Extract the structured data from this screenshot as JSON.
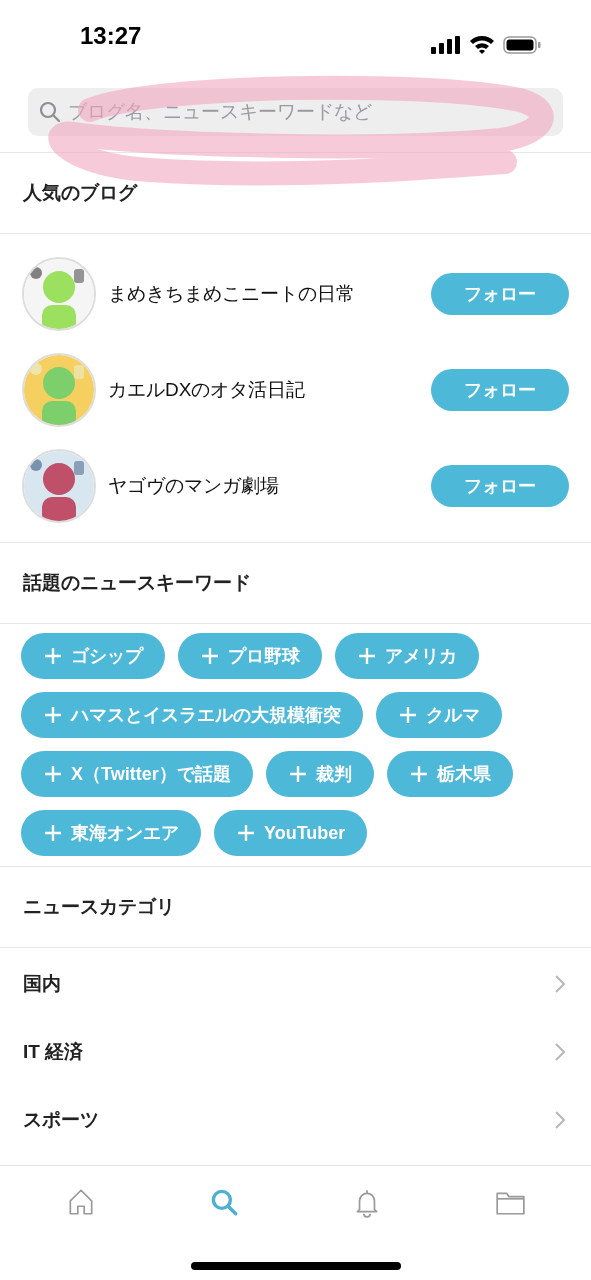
{
  "status_bar": {
    "time": "13:27"
  },
  "search": {
    "placeholder": "ブログ名、ニュースキーワードなど"
  },
  "popular_blogs": {
    "title": "人気のブログ",
    "items": [
      {
        "name": "まめきちまめこニートの日常",
        "button": "フォロー"
      },
      {
        "name": "カエルDXのオタ活日記",
        "button": "フォロー"
      },
      {
        "name": "ヤゴヴのマンガ劇場",
        "button": "フォロー"
      }
    ]
  },
  "keywords": {
    "title": "話題のニュースキーワード",
    "items": [
      "ゴシップ",
      "プロ野球",
      "アメリカ",
      "ハマスとイスラエルの大規模衝突",
      "クルマ",
      "X（Twitter）で話題",
      "裁判",
      "栃木県",
      "東海オンエア",
      "YouTuber"
    ]
  },
  "categories": {
    "title": "ニュースカテゴリ",
    "items": [
      "国内",
      "IT 経済",
      "スポーツ"
    ]
  },
  "tab_bar": [
    {
      "kind": "home",
      "selected": false
    },
    {
      "kind": "search",
      "selected": true
    },
    {
      "kind": "bell",
      "selected": false
    },
    {
      "kind": "folder",
      "selected": false
    }
  ]
}
